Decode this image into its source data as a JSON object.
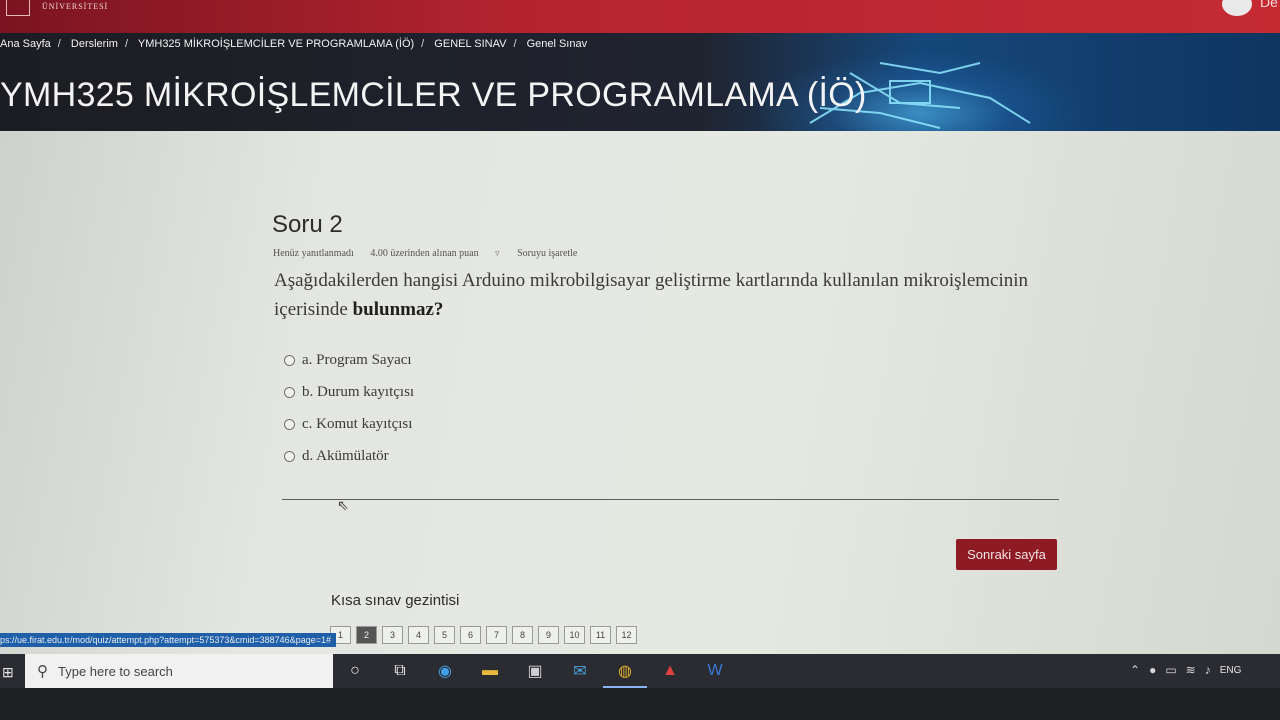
{
  "header": {
    "logo_text": "ÜNİVERSİTESİ",
    "user_initials": "De"
  },
  "breadcrumb": [
    "Ana Sayfa",
    "Derslerim",
    "YMH325 MİKROİŞLEMCİLER VE PROGRAMLAMA (İÖ)",
    "GENEL SINAV",
    "Genel Sınav"
  ],
  "course_title": "YMH325 MİKROİŞLEMCİLER VE PROGRAMLAMA (İÖ)",
  "question": {
    "title": "Soru 2",
    "status": "Henüz yanıtlanmadı",
    "points": "4.00 üzerinden alınan puan",
    "flag_label": "Soruyu işaretle",
    "text_before": "Aşağıdakilerden hangisi Arduino mikrobilgisayar geliştirme kartlarında kullanılan mikroişlemcinin içerisinde ",
    "text_bold": "bulunmaz?",
    "options": [
      "a. Program Sayacı",
      "b. Durum kayıtçısı",
      "c. Komut kayıtçısı",
      "d. Akümülatör"
    ]
  },
  "next_button": "Sonraki sayfa",
  "quiz_nav": {
    "heading": "Kısa sınav gezintisi",
    "pages": [
      "1",
      "2",
      "3",
      "4",
      "5",
      "6",
      "7",
      "8",
      "9",
      "10",
      "11",
      "12"
    ]
  },
  "status_url": "ps://ue.firat.edu.tr/mod/quiz/attempt.php?attempt=575373&cmid=388746&page=1#",
  "taskbar": {
    "search_placeholder": "Type here to search",
    "lang": "ENG"
  }
}
